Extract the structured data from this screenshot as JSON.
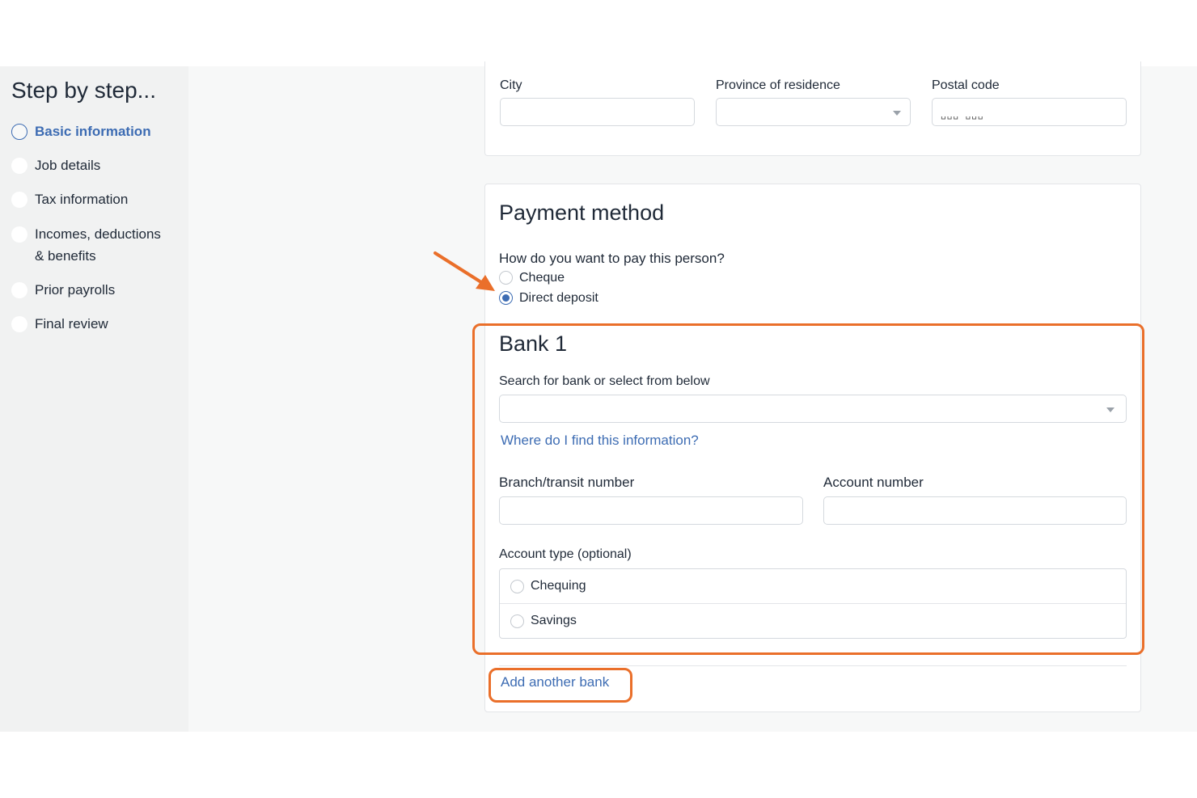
{
  "sidebar": {
    "title": "Step by step...",
    "steps": [
      {
        "label": "Basic information",
        "active": true
      },
      {
        "label": "Job details",
        "active": false
      },
      {
        "label": "Tax information",
        "active": false
      },
      {
        "label": "Incomes, deductions",
        "label2": "& benefits",
        "active": false
      },
      {
        "label": "Prior payrolls",
        "active": false
      },
      {
        "label": "Final review",
        "active": false
      }
    ]
  },
  "address": {
    "city_label": "City",
    "city_value": "",
    "province_label": "Province of residence",
    "province_value": "",
    "postal_label": "Postal code",
    "postal_placeholder": "␣␣␣ ␣␣␣"
  },
  "payment": {
    "title": "Payment method",
    "question": "How do you want to pay this person?",
    "options": [
      {
        "label": "Cheque",
        "selected": false
      },
      {
        "label": "Direct deposit",
        "selected": true
      }
    ]
  },
  "bank": {
    "title": "Bank 1",
    "search_label": "Search for bank or select from below",
    "search_value": "",
    "help_link": "Where do I find this information?",
    "branch_label": "Branch/transit number",
    "branch_value": "",
    "account_label": "Account number",
    "account_value": "",
    "account_type_label": "Account type (optional)",
    "account_types": [
      {
        "label": "Chequing",
        "selected": false
      },
      {
        "label": "Savings",
        "selected": false
      }
    ],
    "add_bank_link": "Add another bank"
  },
  "colors": {
    "accent": "#3d6cb3",
    "highlight": "#ea6f2a",
    "sidebar_bg": "#f1f2f2"
  }
}
